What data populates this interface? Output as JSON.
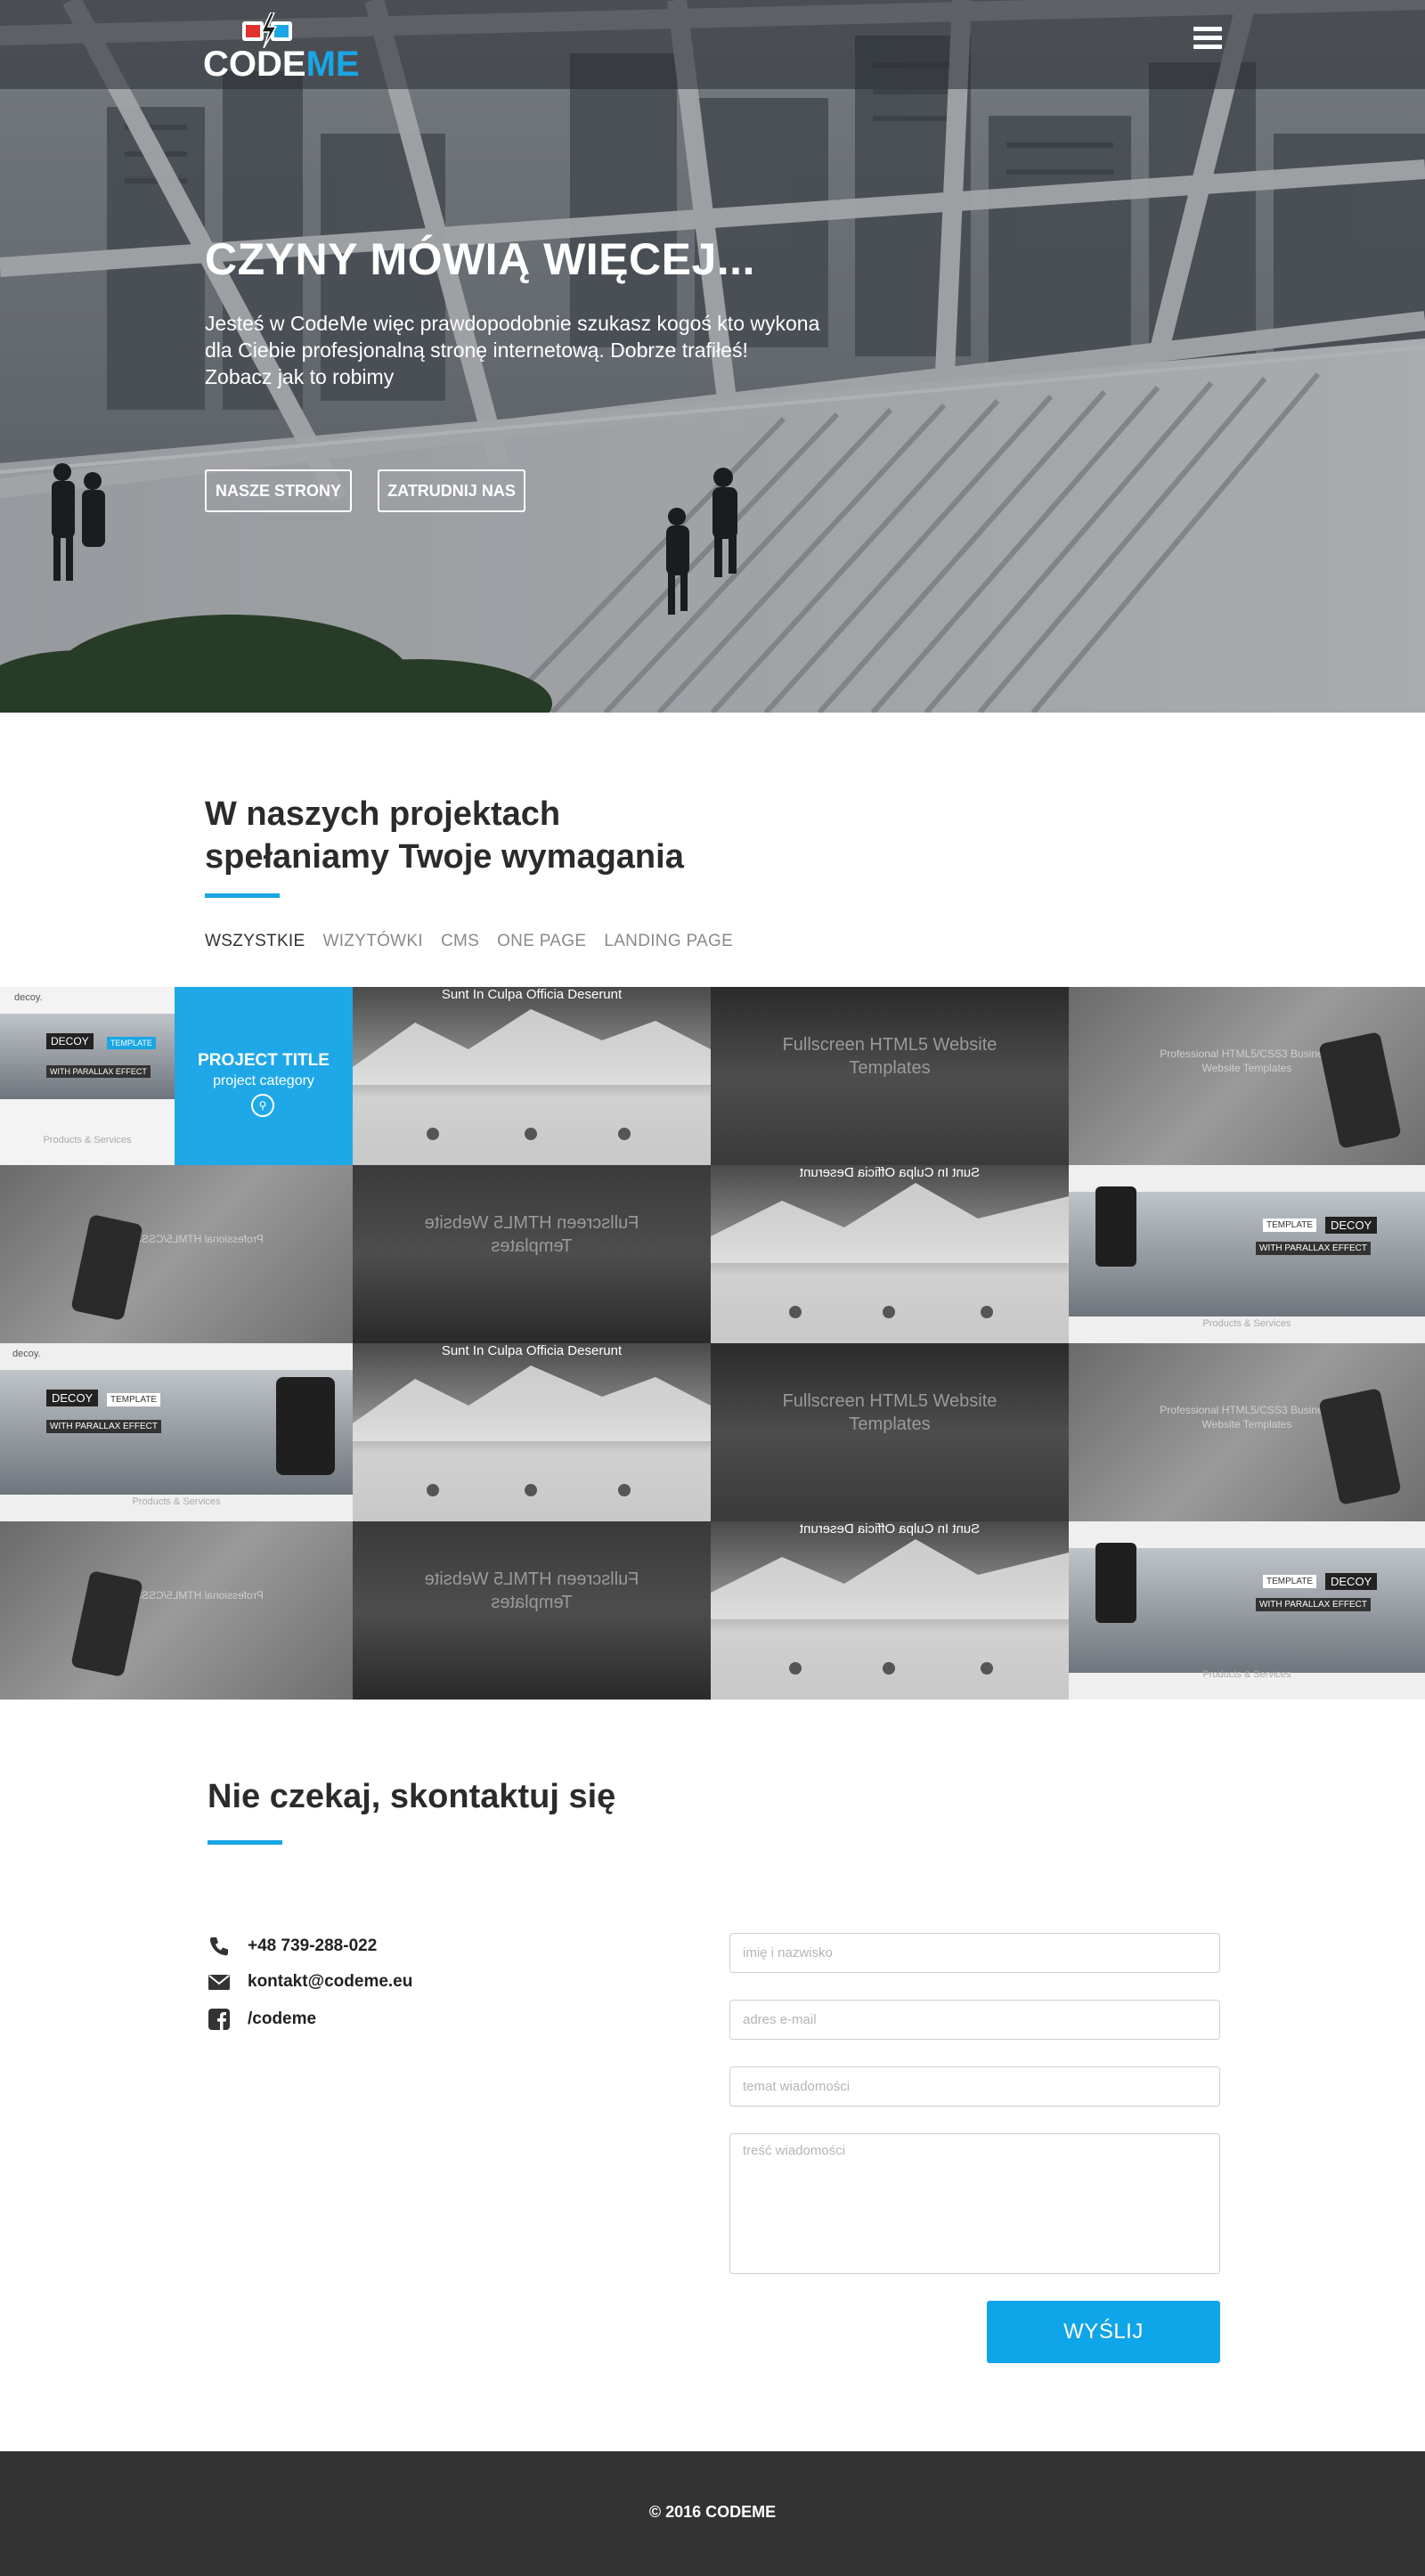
{
  "brand": {
    "logo_text_a": "CODE",
    "logo_text_b": "ME",
    "accent": "#1aa6e4",
    "red": "#e0312f"
  },
  "nav": {
    "menu_icon": "hamburger-icon"
  },
  "hero": {
    "title": "CZYNY MÓWIĄ WIĘCEJ...",
    "lead_line1": "Jesteś w CodeMe więc prawdopodobnie szukasz kogoś kto wykona",
    "lead_line2": "dla Ciebie profesjonalną stronę internetową. Dobrze trafiłeś!",
    "lead_line3": "Zobacz jak to robimy",
    "button_primary": "NASZE STRONY",
    "button_secondary": "ZATRUDNIJ NAS"
  },
  "projects": {
    "title_line1": "W naszych projektach",
    "title_line2": "spełaniamy Twoje wymagania",
    "filters": [
      "WSZYSTKIE",
      "WIZYTÓWKI",
      "CMS",
      "ONE PAGE",
      "LANDING PAGE"
    ],
    "active_filter": "WSZYSTKIE",
    "overlay_title": "PROJECT TITLE",
    "overlay_category": "project category",
    "tile_texts": {
      "sunt": "Sunt In Culpa Officia Deserunt",
      "fullscreen_1": "Fullscreen HTML5 Website",
      "fullscreen_2": "Templates",
      "professional_1": "Professional HTML5/CSS3 Business",
      "professional_2": "Website Templates",
      "decoy": "DECOY",
      "template": "TEMPLATE",
      "parallax": "WITH PARALLAX EFFECT",
      "products": "Products & Services",
      "decoy_logo": "decoy."
    }
  },
  "contact": {
    "title": "Nie czekaj, skontaktuj się",
    "phone": "+48 739-288-022",
    "email": "kontakt@codeme.eu",
    "facebook": "/codeme",
    "name_placeholder": "imię i nazwisko",
    "email_placeholder": "adres e-mail",
    "subject_placeholder": "temat wiadomości",
    "message_placeholder": "treść wiadomości",
    "send_label": "WYŚLIJ"
  },
  "footer": {
    "copyright": "© 2016 CODEME"
  }
}
